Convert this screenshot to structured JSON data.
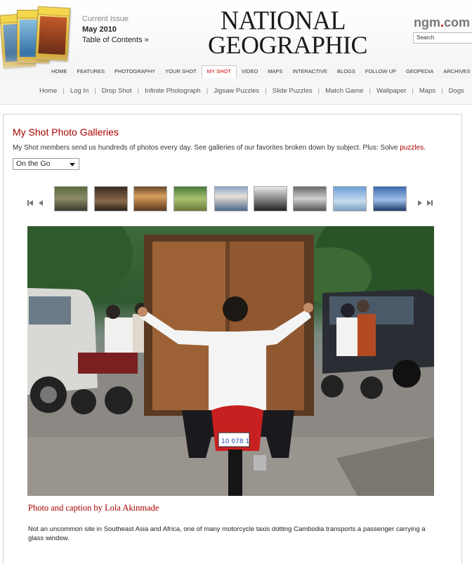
{
  "header": {
    "issue_label": "Current Issue",
    "issue_date": "May 2010",
    "toc_link": "Table of Contents »",
    "logo_line1": "NATIONAL",
    "logo_line2": "GEOGRAPHIC",
    "site_name": "ngm",
    "site_tld": "com",
    "search_placeholder": "Search"
  },
  "main_nav": [
    {
      "label": "HOME",
      "active": false
    },
    {
      "label": "FEATURES",
      "active": false
    },
    {
      "label": "PHOTOGRAPHY",
      "active": false
    },
    {
      "label": "YOUR SHOT",
      "active": false
    },
    {
      "label": "MY SHOT",
      "active": true
    },
    {
      "label": "VIDEO",
      "active": false
    },
    {
      "label": "MAPS",
      "active": false
    },
    {
      "label": "INTERACTIVE",
      "active": false
    },
    {
      "label": "BLOGS",
      "active": false
    },
    {
      "label": "FOLLOW UP",
      "active": false
    },
    {
      "label": "GEOPEDIA",
      "active": false
    },
    {
      "label": "ARCHIVES",
      "active": false
    }
  ],
  "sub_nav": [
    "Home",
    "Log In",
    "Drop Shot",
    "Infinite Photograph",
    "Jigsaw Puzzles",
    "Slide Puzzles",
    "Match Game",
    "Wallpaper",
    "Maps",
    "Dogs"
  ],
  "gallery": {
    "title": "My Shot Photo Galleries",
    "intro": "My Shot members send us hundreds of photos every day. See galleries of our favorites broken down by subject. Plus: Solve",
    "intro_link": "puzzles",
    "intro_end": ".",
    "selected_category": "On the Go",
    "thumbnail_count": 9,
    "photo_byline": "Photo and caption by Lola Akinmade",
    "photo_caption": "Not an uncommon site in Southeast Asia and Africa, one of many motorcycle taxis dotting Cambodia transports a passenger carrying a glass window.",
    "license_plate": "10 078 1"
  },
  "colors": {
    "accent_red": "#a80000",
    "active_nav": "#cc0000",
    "text": "#333333"
  }
}
